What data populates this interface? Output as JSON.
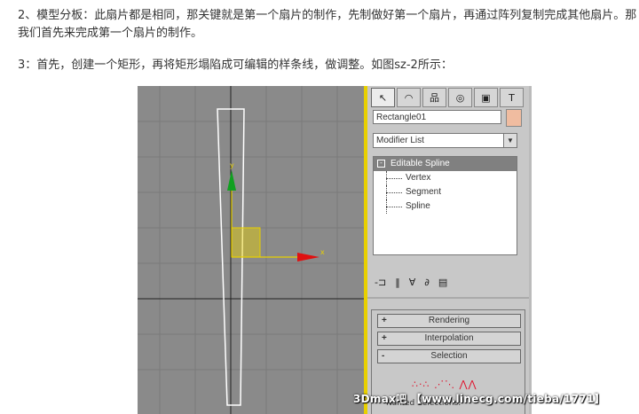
{
  "article": {
    "para1": "2、模型分板：此扇片都是相同，那关键就是第一个扇片的制作，先制做好第一个扇片，再通过阵列复制完成其他扇片。那我们首先来完成第一个扇片的制作。",
    "para2": "3：首先，创建一个矩形，再将矩形塌陷成可编辑的样条线，做调整。如图sz-2所示："
  },
  "viewport": {
    "axis_x_label": "x",
    "axis_y_label": "y",
    "colors": {
      "background": "#8a8a8a",
      "grid": "#7a7a7a",
      "spline": "#ffffff",
      "gizmo_x": "#e01010",
      "gizmo_y": "#10a020",
      "gizmo_plane": "#e8d000"
    }
  },
  "panel": {
    "tabs": [
      "create-icon",
      "modify-icon",
      "hierarchy-icon",
      "motion-icon",
      "display-icon",
      "utilities-icon"
    ],
    "tab_glyphs": [
      "↖",
      "◠",
      "品",
      "◎",
      "▣",
      "T"
    ],
    "object_name": "Rectangle01",
    "object_color": "#f0bca0",
    "modifier_list": "Modifier List",
    "stack": {
      "head": "Editable Spline",
      "subs": [
        "Vertex",
        "Segment",
        "Spline"
      ]
    },
    "stack_tools": [
      "-⊐",
      "‖",
      "∀",
      "∂",
      "▤"
    ],
    "rollouts": [
      {
        "sign": "+",
        "label": "Rendering"
      },
      {
        "sign": "+",
        "label": "Interpolation"
      },
      {
        "sign": "-",
        "label": "Selection"
      }
    ],
    "selection_icons": "∴·∴ ⋰⋱ ⋀⋀",
    "named_selections": "Named Selections:"
  },
  "watermark": "3Dmax吧 【www.linecg.com/tieba/1771】"
}
